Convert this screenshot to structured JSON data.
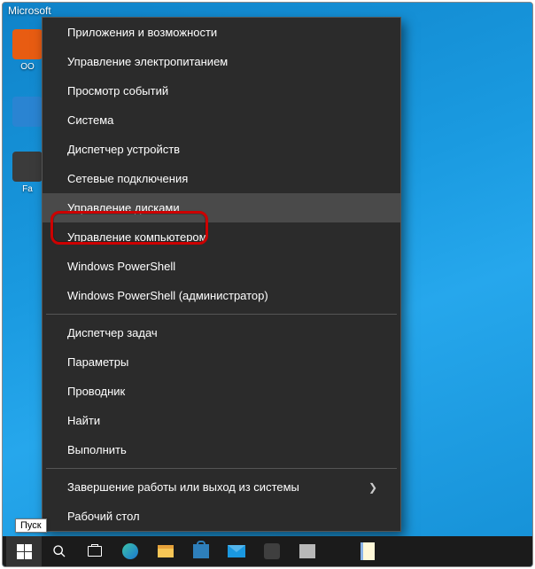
{
  "desktop": {
    "top_label": "Microsoft",
    "icons": [
      {
        "text": "OO",
        "color": "#e85c12"
      },
      {
        "text": "",
        "color": "#2a84d2"
      },
      {
        "text": "Fa",
        "color": "#3b3b3b"
      }
    ],
    "tooltip": "Пуск"
  },
  "menu": {
    "groups": [
      [
        "Приложения и возможности",
        "Управление электропитанием",
        "Просмотр событий",
        "Система",
        "Диспетчер устройств",
        "Сетевые подключения",
        "Управление дисками",
        "Управление компьютером",
        "Windows PowerShell",
        "Windows PowerShell (администратор)"
      ],
      [
        "Диспетчер задач",
        "Параметры",
        "Проводник",
        "Найти",
        "Выполнить"
      ],
      [
        {
          "label": "Завершение работы или выход из системы",
          "submenu": true
        },
        "Рабочий стол"
      ]
    ],
    "highlighted": "Управление дисками"
  }
}
